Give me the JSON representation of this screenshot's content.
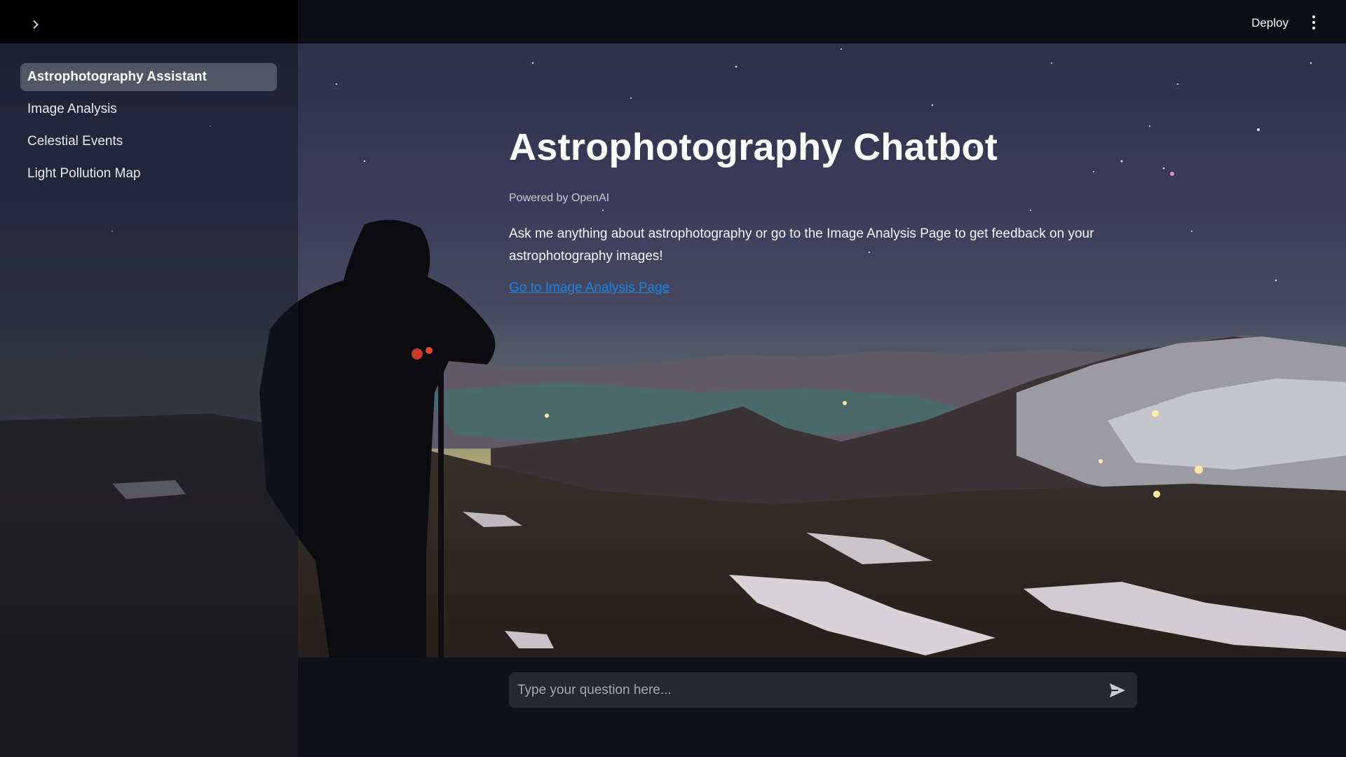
{
  "header": {
    "deploy_label": "Deploy",
    "expand_icon": "chevron-right-icon",
    "menu_icon": "more-vertical-icon"
  },
  "sidebar": {
    "items": [
      {
        "label": "Astrophotography Assistant",
        "active": true
      },
      {
        "label": "Image Analysis",
        "active": false
      },
      {
        "label": "Celestial Events",
        "active": false
      },
      {
        "label": "Light Pollution Map",
        "active": false
      }
    ]
  },
  "main": {
    "title": "Astrophotography Chatbot",
    "subtitle": "Powered by OpenAI",
    "description": "Ask me anything about astrophotography or go to the Image Analysis Page to get feedback on your astrophotography images!",
    "link_label": "Go to Image Analysis Page"
  },
  "chat": {
    "placeholder": "Type your question here...",
    "value": "",
    "send_icon": "send-icon"
  },
  "colors": {
    "background": "#0e1117",
    "link": "#1c83e1",
    "input_bg": "#262730",
    "active_nav": "#7f8491"
  }
}
